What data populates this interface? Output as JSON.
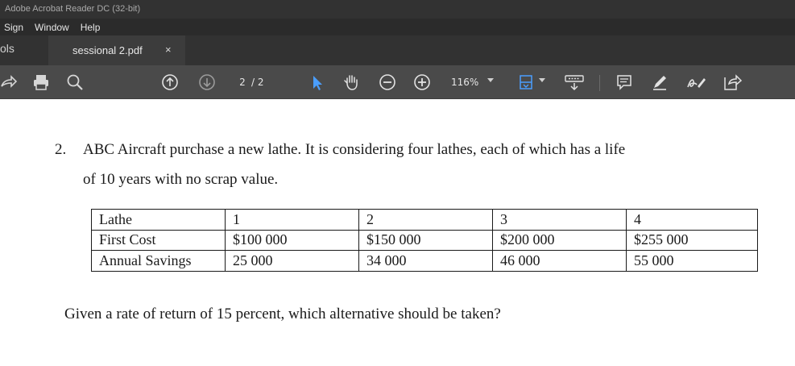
{
  "app": {
    "title": "Adobe Acrobat Reader DC (32-bit)"
  },
  "menu": {
    "items": [
      "Sign",
      "Window",
      "Help"
    ]
  },
  "tabs": {
    "tools_label": "ols",
    "document_tab": "sessional 2.pdf",
    "close_glyph": "×"
  },
  "toolbar": {
    "page_current": "2",
    "page_total": "/ 2",
    "zoom": "116%",
    "icons": [
      "share-icon",
      "print-icon",
      "search-icon",
      "page-up-icon",
      "page-down-icon",
      "select-cursor-icon",
      "hand-icon",
      "zoom-out-icon",
      "zoom-in-icon",
      "fit-page-icon",
      "keyboard-icon",
      "comment-icon",
      "highlight-pen-icon",
      "sign-icon",
      "share-send-icon"
    ],
    "accent_color": "#4a9eff"
  },
  "document": {
    "question_number": "2.",
    "line1": "ABC Aircraft purchase a new lathe. It is considering four lathes, each of which has a life",
    "line2": "of 10 years with no scrap value.",
    "table": {
      "rows": [
        [
          "Lathe",
          "1",
          "2",
          "3",
          "4"
        ],
        [
          "First Cost",
          "$100 000",
          "$150 000",
          "$200 000",
          "$255 000"
        ],
        [
          "Annual Savings",
          "25 000",
          "34 000",
          "46 000",
          "55 000"
        ]
      ]
    },
    "given": "Given a rate of return of 15 percent, which alternative should be taken?"
  }
}
